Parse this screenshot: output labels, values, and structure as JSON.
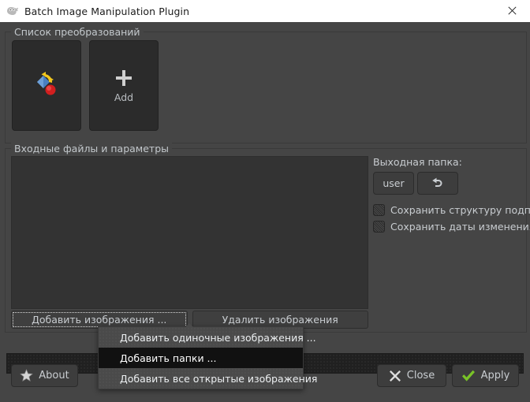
{
  "window": {
    "title": "Batch Image Manipulation Plugin",
    "icon": "wilber-icon",
    "close_icon": "close-icon"
  },
  "transforms_group": {
    "legend": "Список преобразований",
    "tiles": [
      {
        "label": "",
        "icon": "transform-rotate-icon"
      },
      {
        "label": "Add",
        "icon": "plus-icon"
      }
    ]
  },
  "inputs_group": {
    "legend": "Входные файлы и параметры",
    "file_list_items": [],
    "buttons": [
      {
        "label": "Добавить изображения ...",
        "focused": true
      },
      {
        "label": "Удалить изображения",
        "focused": false
      }
    ]
  },
  "output_panel": {
    "title": "Выходная папка:",
    "folder_button": "user",
    "reset_button_icon": "undo-arrow-icon",
    "checkboxes": [
      {
        "label": "Сохранить структуру подпапок",
        "checked": false
      },
      {
        "label": "Сохранить даты изменения",
        "checked": false
      }
    ]
  },
  "progress": {
    "value": 0,
    "text": ""
  },
  "footer": {
    "about": {
      "label": "About",
      "icon": "star-icon"
    },
    "close": {
      "label": "Close",
      "icon": "cross-icon"
    },
    "apply": {
      "label": "Apply",
      "icon": "check-icon"
    }
  },
  "context_menu": {
    "items": [
      {
        "label": "Добавить одиночные изображения ...",
        "selected": false
      },
      {
        "label": "Добавить папки ...",
        "selected": true
      },
      {
        "label": "Добавить все открытые изображения",
        "selected": false
      }
    ]
  },
  "colors": {
    "window_background": "#454545",
    "panel_dark": "#333333",
    "tile_background": "#2b2b2b",
    "titlebar_background": "#ffffff",
    "accent_apply": "#79c327",
    "menu_selected": "#111111"
  }
}
